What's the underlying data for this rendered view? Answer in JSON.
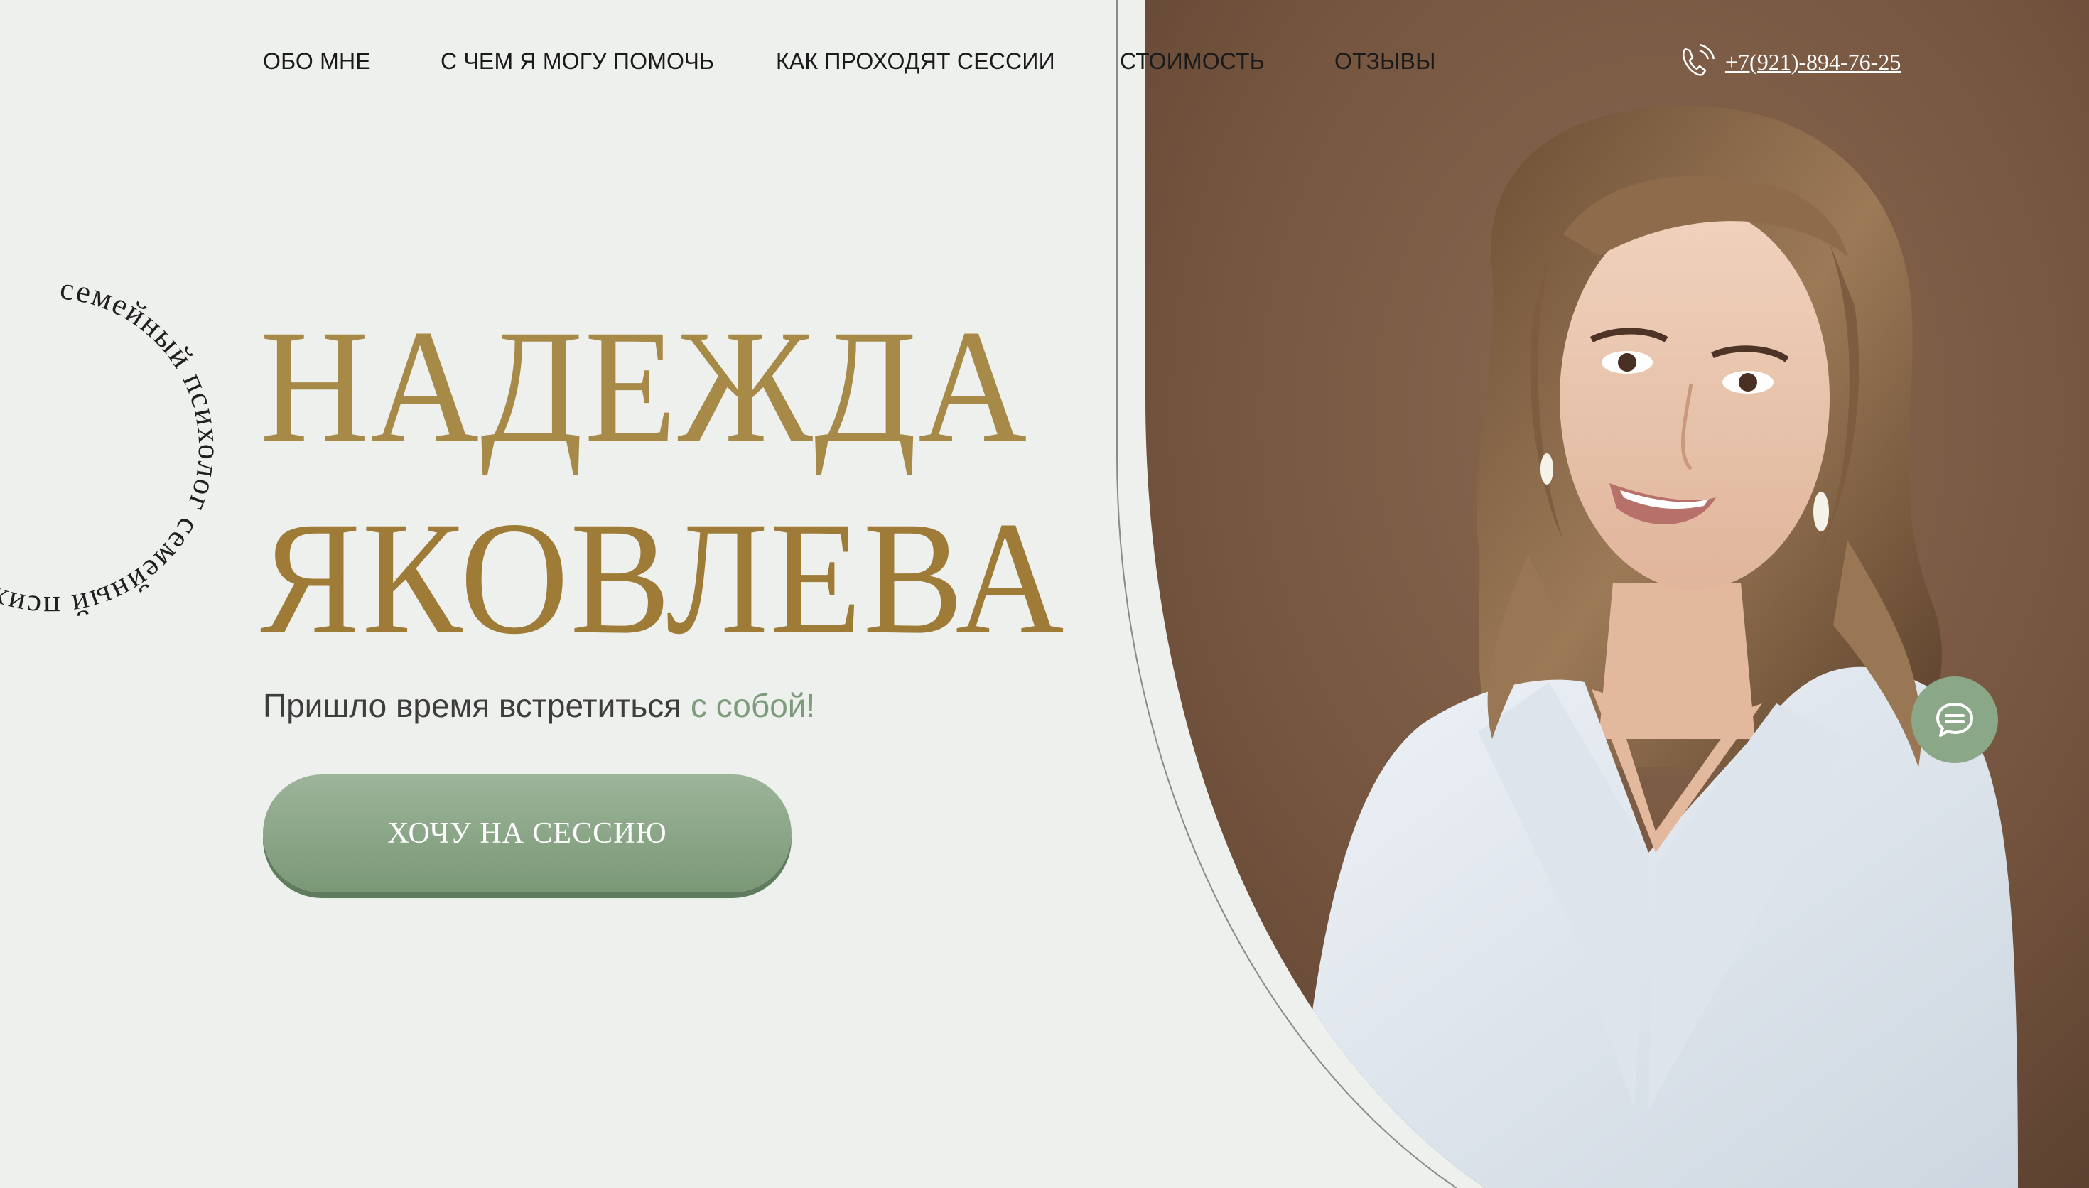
{
  "nav": {
    "items": [
      {
        "label": "ОБО МНЕ"
      },
      {
        "label": "С ЧЕМ Я МОГУ ПОМОЧЬ"
      },
      {
        "label": "КАК ПРОХОДЯТ СЕССИИ"
      },
      {
        "label": "СТОИМОСТЬ"
      },
      {
        "label": "ОТЗЫВЫ"
      }
    ],
    "phone": "+7(921)-894-76-25"
  },
  "hero": {
    "circle_text": "семейный психолог",
    "name_first": "НАДЕЖДА",
    "name_last": "ЯКОВЛЕВА",
    "tagline_main": "Пришло время встретиться ",
    "tagline_accent": "с собой!",
    "cta_label": "ХОЧУ НА СЕССИЮ"
  },
  "icons": {
    "phone": "phone-icon",
    "chat": "chat-icon"
  },
  "colors": {
    "background": "#eef0ed",
    "gold": "#a88a48",
    "accent_green": "#7d9b7d",
    "photo_backdrop": "#7a5a44"
  }
}
